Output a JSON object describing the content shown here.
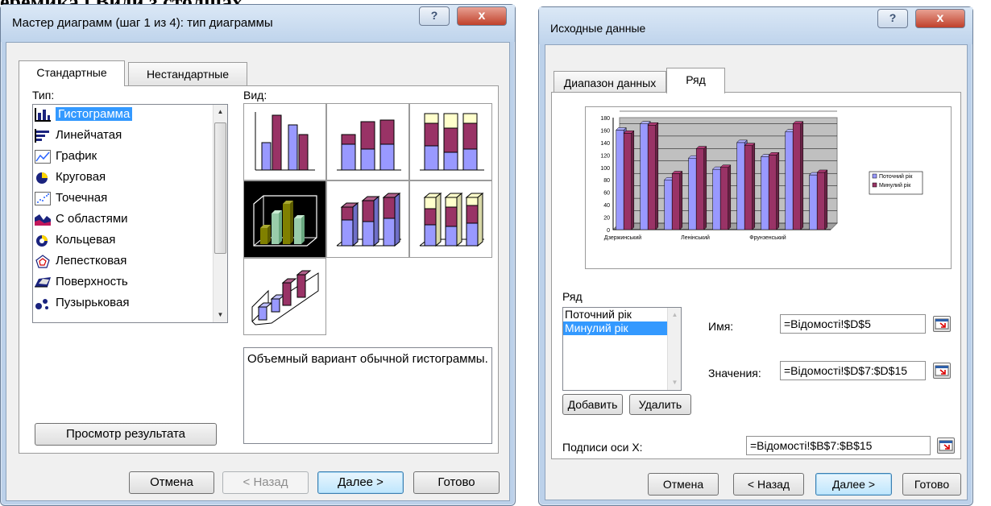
{
  "page_heading": "еремика і Види з столщах.",
  "colors": {
    "bar_blue": "#9999ff",
    "bar_purple": "#993366",
    "plot_bg": "#c0c0c0",
    "selection": "#3399ff"
  },
  "wizard": {
    "title": "Мастер диаграмм (шаг 1 из 4): тип диаграммы",
    "help_label": "?",
    "close_label": "x",
    "tabs": [
      "Стандартные",
      "Нестандартные"
    ],
    "type_label": "Тип:",
    "view_label": "Вид:",
    "types": [
      "Гистограмма",
      "Линейчатая",
      "График",
      "Круговая",
      "Точечная",
      "С областями",
      "Кольцевая",
      "Лепестковая",
      "Поверхность",
      "Пузырьковая"
    ],
    "selected_type": "Гистограмма",
    "description": "Объемный вариант обычной гистограммы.",
    "preview_button": "Просмотр результата",
    "buttons": {
      "cancel": "Отмена",
      "back": "< Назад",
      "next": "Далее >",
      "finish": "Готово"
    }
  },
  "source": {
    "title": "Исходные данные",
    "help_label": "?",
    "close_label": "x",
    "tabs": [
      "Диапазон данных",
      "Ряд"
    ],
    "series_label": "Ряд",
    "series": [
      "Поточний рік",
      "Минулий рік"
    ],
    "selected_series": "Минулий рік",
    "name_label": "Имя:",
    "name_value": "=Відомості!$D$5",
    "values_label": "Значения:",
    "values_value": "=Відомості!$D$7:$D$15",
    "add_button": "Добавить",
    "remove_button": "Удалить",
    "x_labels_label": "Подписи оси X:",
    "x_labels_value": "=Відомості!$B$7:$B$15",
    "buttons": {
      "cancel": "Отмена",
      "back": "< Назад",
      "next": "Далее >",
      "finish": "Готово"
    }
  },
  "chart_data": {
    "type": "bar",
    "categories": [
      "Дзержинський",
      "",
      "",
      "Ленінський",
      "",
      "",
      "Фрунзенський",
      "",
      ""
    ],
    "series": [
      {
        "name": "Поточний рік",
        "values": [
          160,
          170,
          80,
          115,
          97,
          140,
          117,
          157,
          88
        ]
      },
      {
        "name": "Минулий рік",
        "values": [
          155,
          168,
          90,
          130,
          100,
          135,
          120,
          170,
          92
        ]
      }
    ],
    "ylim": [
      0,
      180
    ],
    "yticks": [
      0,
      20,
      40,
      60,
      80,
      100,
      120,
      140,
      160,
      180
    ],
    "legend": "right"
  }
}
